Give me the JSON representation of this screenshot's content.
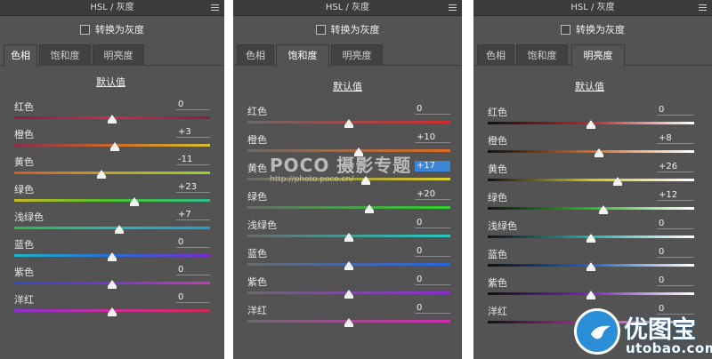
{
  "panels": [
    {
      "title": "HSL / 灰度",
      "grayscale_label": "转换为灰度",
      "tabs": [
        "色相",
        "饱和度",
        "明亮度"
      ],
      "active_tab": 0,
      "default_label": "默认值",
      "sliders": [
        {
          "label": "红色",
          "value": "0"
        },
        {
          "label": "橙色",
          "value": "+3"
        },
        {
          "label": "黄色",
          "value": "-11"
        },
        {
          "label": "绿色",
          "value": "+23"
        },
        {
          "label": "浅绿色",
          "value": "+7"
        },
        {
          "label": "蓝色",
          "value": "0"
        },
        {
          "label": "紫色",
          "value": "0"
        },
        {
          "label": "洋红",
          "value": "0"
        }
      ]
    },
    {
      "title": "HSL / 灰度",
      "grayscale_label": "转换为灰度",
      "tabs": [
        "色相",
        "饱和度",
        "明亮度"
      ],
      "active_tab": 1,
      "default_label": "默认值",
      "sliders": [
        {
          "label": "红色",
          "value": "0"
        },
        {
          "label": "橙色",
          "value": "+10"
        },
        {
          "label": "黄色",
          "value": "+17"
        },
        {
          "label": "绿色",
          "value": "+20"
        },
        {
          "label": "浅绿色",
          "value": "0"
        },
        {
          "label": "蓝色",
          "value": "0"
        },
        {
          "label": "紫色",
          "value": "0"
        },
        {
          "label": "洋红",
          "value": "0"
        }
      ]
    },
    {
      "title": "HSL / 灰度",
      "grayscale_label": "转换为灰度",
      "tabs": [
        "色相",
        "饱和度",
        "明亮度"
      ],
      "active_tab": 2,
      "default_label": "默认值",
      "sliders": [
        {
          "label": "红色",
          "value": "0"
        },
        {
          "label": "橙色",
          "value": "+8"
        },
        {
          "label": "黄色",
          "value": "+26"
        },
        {
          "label": "绿色",
          "value": "+12"
        },
        {
          "label": "浅绿色",
          "value": "0"
        },
        {
          "label": "蓝色",
          "value": "0"
        },
        {
          "label": "紫色",
          "value": "0"
        },
        {
          "label": "洋红",
          "value": "0"
        }
      ]
    }
  ],
  "watermark": {
    "brand": "POCO 摄影专题",
    "url": "http://photo.poco.cn/"
  },
  "logo": {
    "name": "优图宝",
    "domain": "utobao.com"
  }
}
